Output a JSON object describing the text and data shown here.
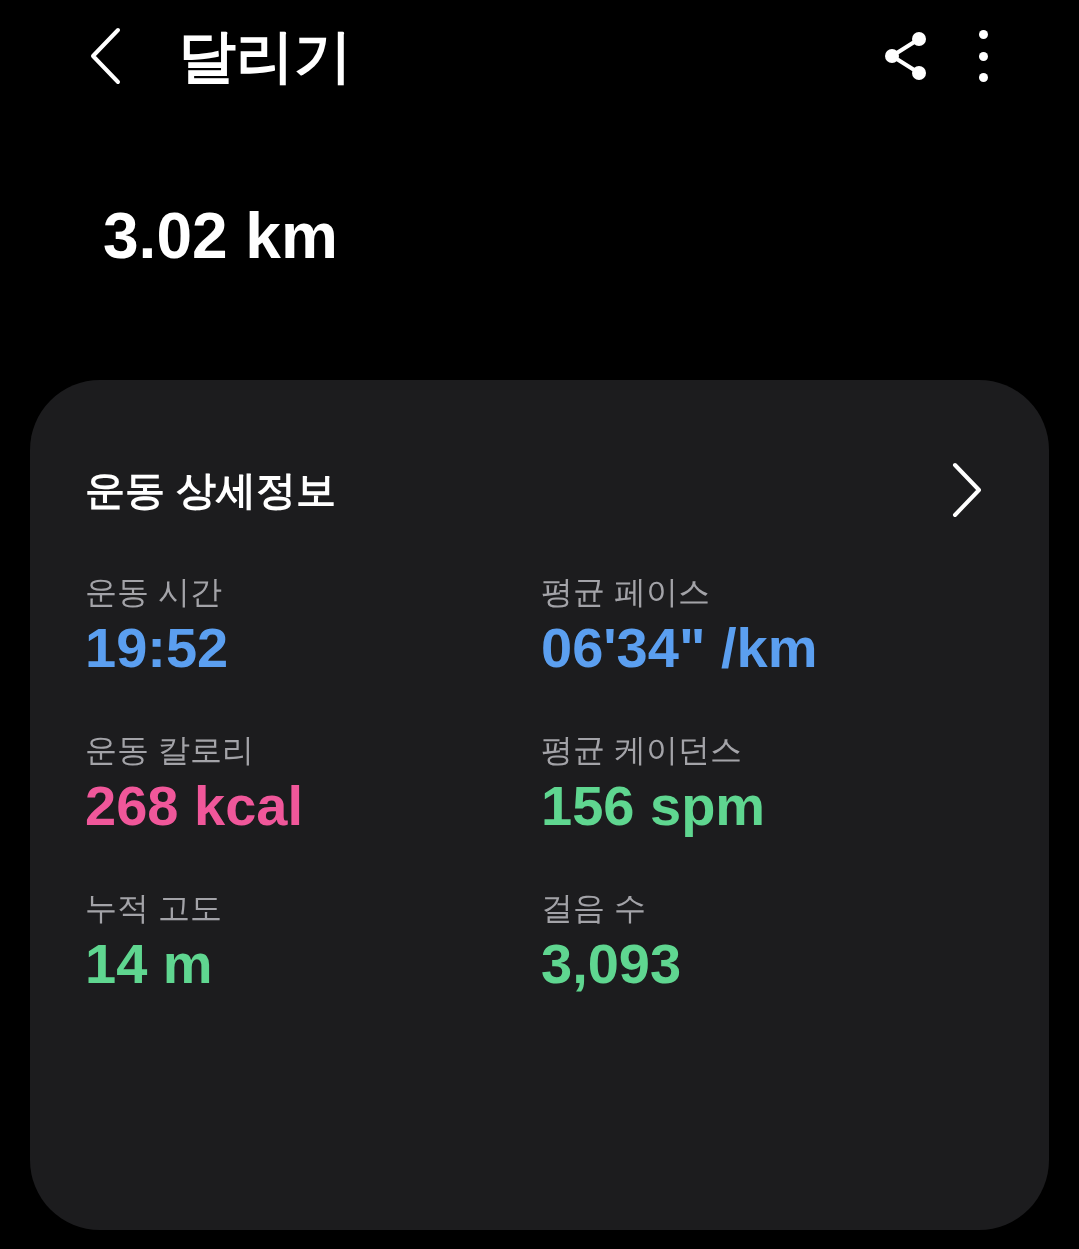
{
  "header": {
    "title": "달리기"
  },
  "distance": "3.02 km",
  "details_card": {
    "title": "운동 상세정보",
    "stats": [
      {
        "label": "운동 시간",
        "value": "19:52",
        "color": "#5b9ff0"
      },
      {
        "label": "평균 페이스",
        "value": "06'34\" /km",
        "color": "#5b9ff0"
      },
      {
        "label": "운동 칼로리",
        "value": "268 kcal",
        "color": "#f0579a"
      },
      {
        "label": "평균 케이던스",
        "value": "156 spm",
        "color": "#5fd690"
      },
      {
        "label": "누적 고도",
        "value": "14 m",
        "color": "#5fd690"
      },
      {
        "label": "걸음 수",
        "value": "3,093",
        "color": "#5fd690"
      }
    ]
  }
}
